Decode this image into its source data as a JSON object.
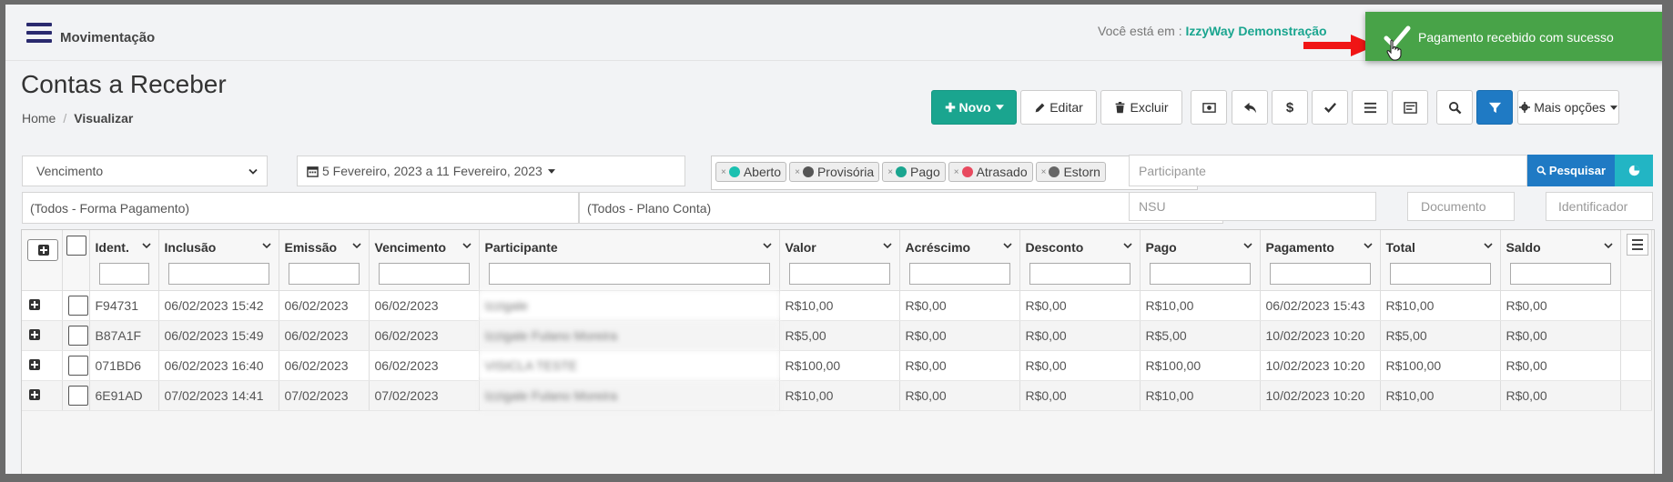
{
  "topbar": {
    "module": "Movimentação",
    "location_prefix": "Você está em :",
    "location_company": "IzzyWay Demonstração"
  },
  "toast": {
    "message": "Pagamento recebido com sucesso",
    "color": "#48a348"
  },
  "page": {
    "title": "Contas a Receber",
    "breadcrumb": {
      "home": "Home",
      "separator": "/",
      "current": "Visualizar"
    }
  },
  "toolbar": {
    "novo": "Novo",
    "editar": "Editar",
    "excluir": "Excluir",
    "mais_opcoes": "Mais opções",
    "dollar": "$"
  },
  "filters": {
    "date_type": "Vencimento",
    "date_range": "5 Fevereiro, 2023 a 11 Fevereiro, 2023",
    "forma_pagamento": "(Todos - Forma Pagamento)",
    "plano_conta": "(Todos - Plano Conta)",
    "participante_placeholder": "Participante",
    "nsu_placeholder": "NSU",
    "documento_placeholder": "Documento",
    "identificador_placeholder": "Identificador",
    "search_label": "Pesquisar",
    "status_tags": [
      {
        "label": "Aberto",
        "color": "#1bc0b0"
      },
      {
        "label": "Provisória",
        "color": "#555555"
      },
      {
        "label": "Pago",
        "color": "#1aa58f"
      },
      {
        "label": "Atrasado",
        "color": "#e84a5f"
      },
      {
        "label": "Estorn",
        "color": "#666666"
      }
    ]
  },
  "grid": {
    "columns": [
      "Ident.",
      "Inclusão",
      "Emissão",
      "Vencimento",
      "Participante",
      "Valor",
      "Acréscimo",
      "Desconto",
      "Pago",
      "Pagamento",
      "Total",
      "Saldo"
    ],
    "rows": [
      {
        "ident": "F94731",
        "inclusao": "06/02/2023 15:42",
        "emissao": "06/02/2023",
        "vencimento": "06/02/2023",
        "participante": "Izzigale",
        "valor": "R$10,00",
        "acrescimo": "R$0,00",
        "desconto": "R$0,00",
        "pago": "R$10,00",
        "pagamento": "06/02/2023 15:43",
        "total": "R$10,00",
        "saldo": "R$0,00"
      },
      {
        "ident": "B87A1F",
        "inclusao": "06/02/2023 15:49",
        "emissao": "06/02/2023",
        "vencimento": "06/02/2023",
        "participante": "Izzigale Fulano Moreira",
        "valor": "R$5,00",
        "acrescimo": "R$0,00",
        "desconto": "R$0,00",
        "pago": "R$5,00",
        "pagamento": "10/02/2023 10:20",
        "total": "R$5,00",
        "saldo": "R$0,00"
      },
      {
        "ident": "071BD6",
        "inclusao": "06/02/2023 16:40",
        "emissao": "06/02/2023",
        "vencimento": "06/02/2023",
        "participante": "VISICLA TESTE",
        "valor": "R$100,00",
        "acrescimo": "R$0,00",
        "desconto": "R$0,00",
        "pago": "R$100,00",
        "pagamento": "10/02/2023 10:20",
        "total": "R$100,00",
        "saldo": "R$0,00"
      },
      {
        "ident": "6E91AD",
        "inclusao": "07/02/2023 14:41",
        "emissao": "07/02/2023",
        "vencimento": "07/02/2023",
        "participante": "Izzigale Fulano Moreira",
        "valor": "R$10,00",
        "acrescimo": "R$0,00",
        "desconto": "R$0,00",
        "pago": "R$10,00",
        "pagamento": "10/02/2023 10:20",
        "total": "R$10,00",
        "saldo": "R$0,00"
      }
    ]
  }
}
